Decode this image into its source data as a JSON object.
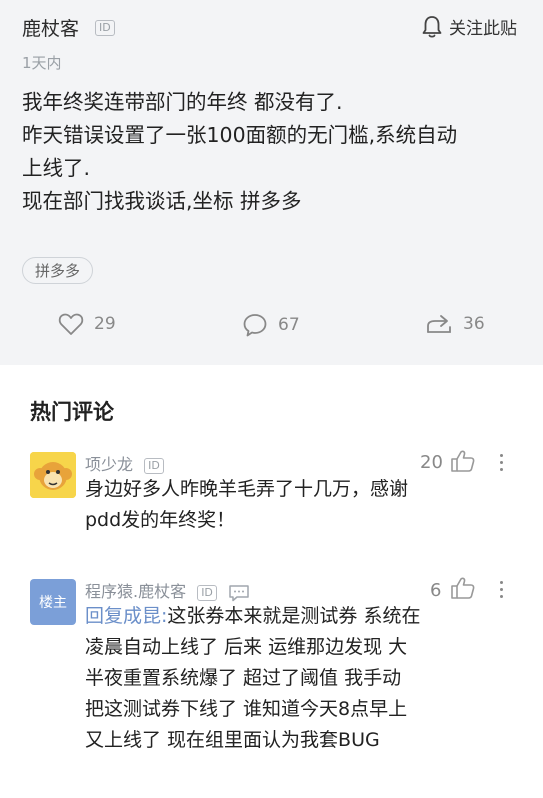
{
  "post": {
    "author": "鹿杖客",
    "id_badge": "ID",
    "follow_label": "关注此贴",
    "time": "1天内",
    "lines": [
      "我年终奖连带部门的年终 都没有了.",
      "昨天错误设置了一张100面额的无门槛,系统自动",
      "上线了.",
      "现在部门找我谈话,坐标 拼多多"
    ],
    "tag": "拼多多",
    "likes": "29",
    "comments": "67",
    "shares": "36"
  },
  "hot_comments": {
    "title": "热门评论",
    "items": [
      {
        "name": "项少龙",
        "id_badge": "ID",
        "likes": "20",
        "lines": [
          "身边好多人昨晚羊毛弄了十几万，感谢",
          "pdd发的年终奖！"
        ]
      },
      {
        "name": "程序猿.鹿杖客",
        "id_badge": "ID",
        "avatar_label": "楼主",
        "likes": "6",
        "reply_prefix": "回复成昆:",
        "lines": [
          "这张券本来就是测试券 系统在",
          "凌晨自动上线了 后来 运维那边发现 大",
          "半夜重置系统爆了 超过了阈值  我手动",
          "把这测试券下线了 谁知道今天8点早上",
          "又上线了 现在组里面认为我套BUG"
        ]
      }
    ]
  },
  "colors": {
    "accent_blue": "#6b8fc9",
    "post_bg": "#f3f4f6",
    "avatar_blue": "#7b9fd8",
    "avatar_yellow": "#f5c518"
  },
  "icons": [
    "bell-icon",
    "heart-icon",
    "comment-icon",
    "share-icon",
    "thumb-up-icon",
    "more-icon",
    "chat-icon"
  ]
}
